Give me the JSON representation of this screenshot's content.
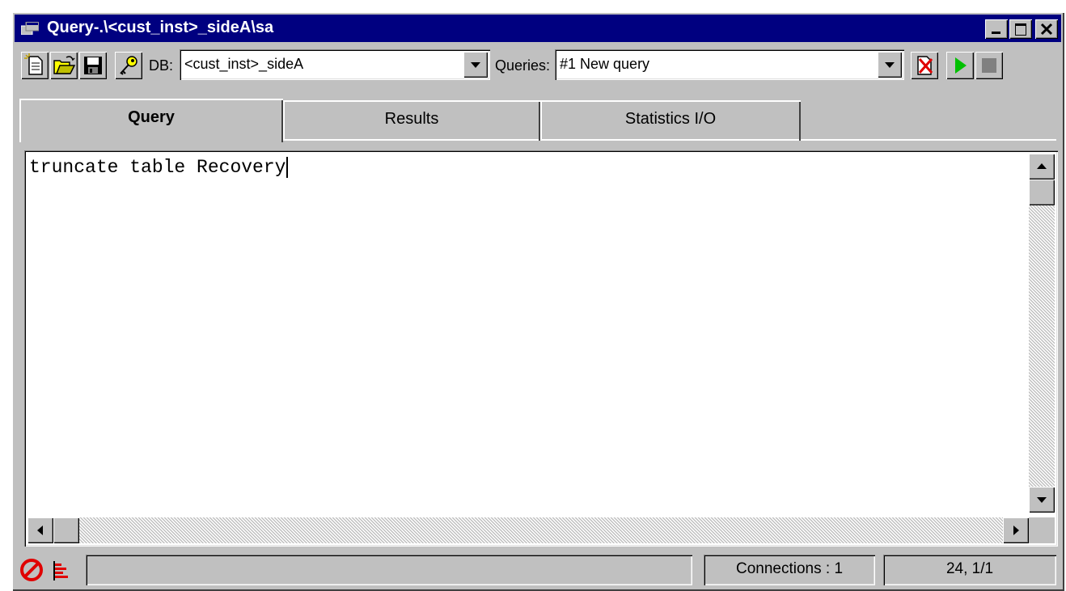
{
  "window": {
    "title": "Query-.\\<cust_inst>_sideA\\sa"
  },
  "toolbar": {
    "db_label": "DB:",
    "db_value": "<cust_inst>_sideA",
    "queries_label": "Queries:",
    "queries_value": "#1 New query",
    "icons": [
      "new-document-icon",
      "open-folder-icon",
      "save-disk-icon",
      "key-icon",
      "delete-query-icon",
      "execute-play-icon",
      "stop-icon"
    ]
  },
  "tabs": [
    {
      "label": "Query",
      "active": true
    },
    {
      "label": "Results",
      "active": false
    },
    {
      "label": "Statistics I/O",
      "active": false
    }
  ],
  "editor": {
    "text": "truncate table Recovery"
  },
  "statusbar": {
    "connections": "Connections : 1",
    "position": "24, 1/1"
  },
  "colors": {
    "titlebar": "#000080",
    "face": "#c0c0c0",
    "play": "#00c000",
    "stop_icon": "#e00000"
  }
}
